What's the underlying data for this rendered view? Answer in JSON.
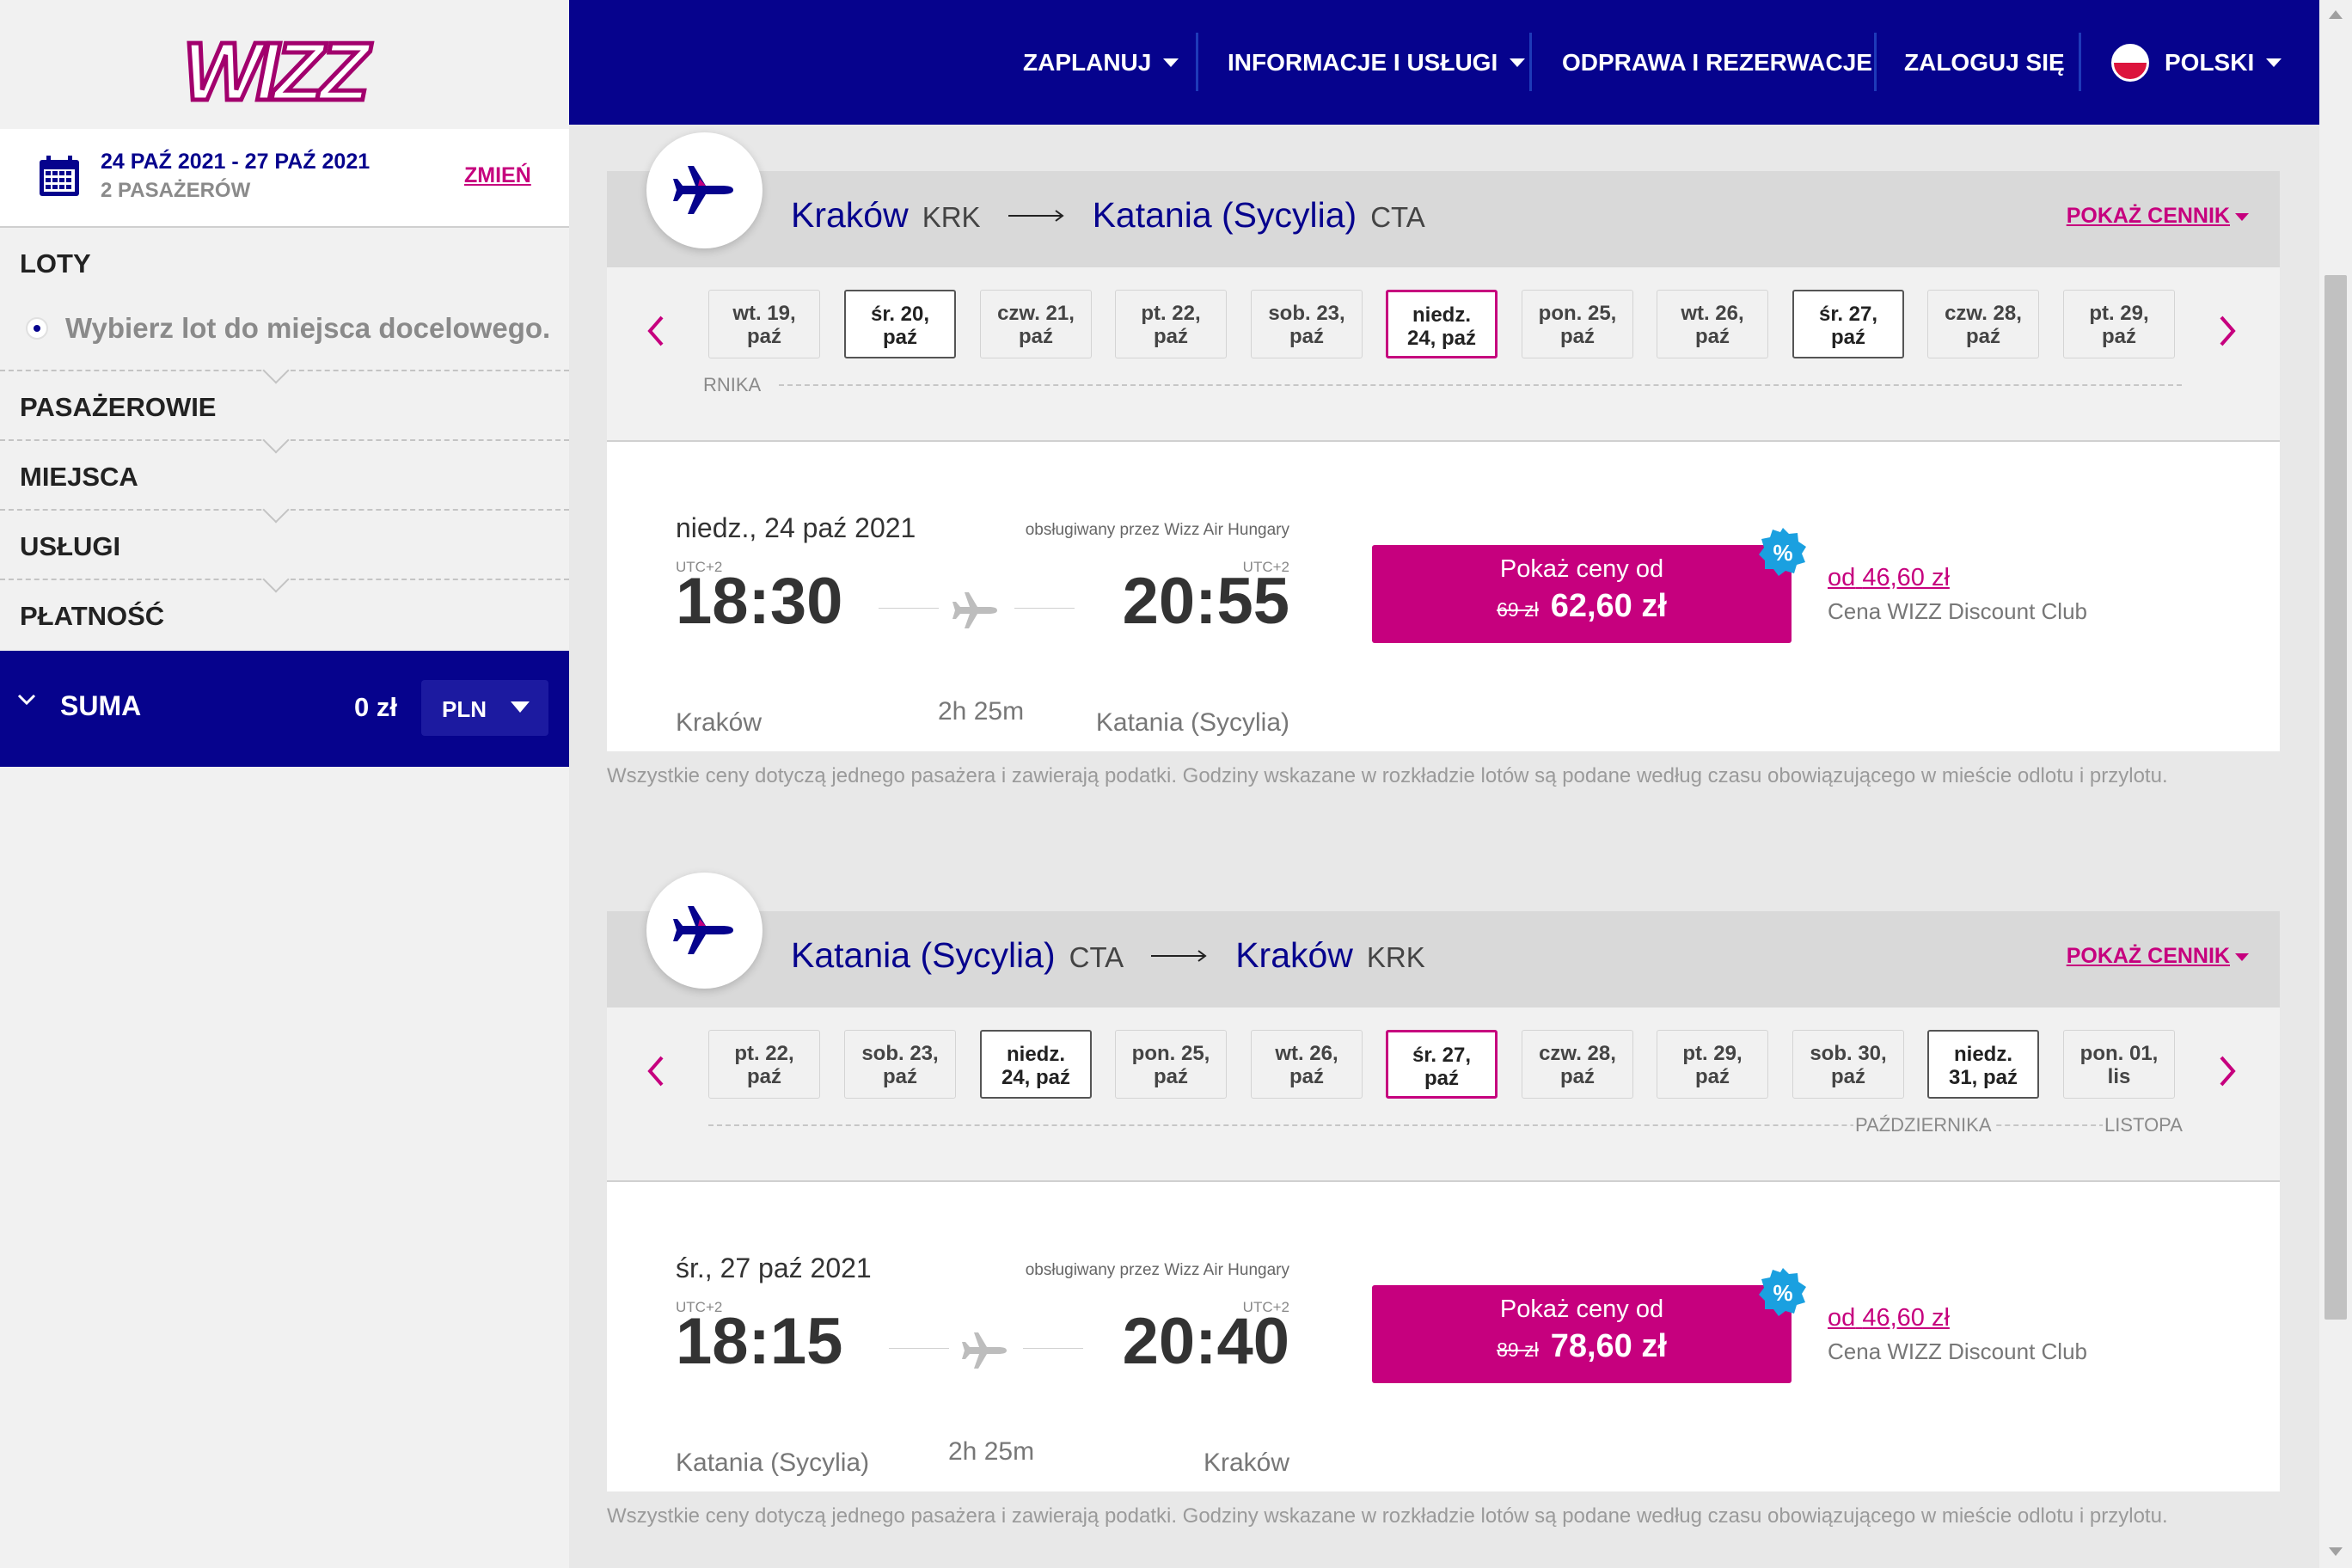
{
  "colors": {
    "brand_navy": "#06038d",
    "brand_magenta": "#c6007e",
    "discount_blue": "#1aa0e0"
  },
  "logo": {
    "text": "WIZZ"
  },
  "trip": {
    "dates": "24 PAŹ 2021 - 27 PAŹ 2021",
    "passengers": "2 PASAŻERÓW",
    "change_label": "ZMIEŃ"
  },
  "steps": [
    {
      "label": "LOTY",
      "sub": "Wybierz lot do miejsca docelowego."
    },
    {
      "label": "PASAŻEROWIE"
    },
    {
      "label": "MIEJSCA"
    },
    {
      "label": "USŁUGI"
    },
    {
      "label": "PŁATNOŚĆ"
    }
  ],
  "total": {
    "label": "SUMA",
    "amount": "0 zł",
    "currency": "PLN"
  },
  "nav": {
    "plan": "ZAPLANUJ",
    "info": "INFORMACJE I USŁUGI",
    "checkin": "ODPRAWA I REZERWACJE",
    "login": "ZALOGUJ SIĘ",
    "language": "POLSKI"
  },
  "flights": [
    {
      "from_city": "Kraków",
      "from_code": "KRK",
      "to_city": "Katania (Sycylia)",
      "to_code": "CTA",
      "show_prices": "POKAŻ CENNIK",
      "dates": [
        {
          "l1": "wt. 19,",
          "l2": "paź",
          "state": "none"
        },
        {
          "l1": "śr. 20,",
          "l2": "paź",
          "state": "avail"
        },
        {
          "l1": "czw. 21,",
          "l2": "paź",
          "state": "none"
        },
        {
          "l1": "pt. 22,",
          "l2": "paź",
          "state": "none"
        },
        {
          "l1": "sob. 23,",
          "l2": "paź",
          "state": "none"
        },
        {
          "l1": "niedz.",
          "l2": "24, paź",
          "state": "selected"
        },
        {
          "l1": "pon. 25,",
          "l2": "paź",
          "state": "none"
        },
        {
          "l1": "wt. 26,",
          "l2": "paź",
          "state": "none"
        },
        {
          "l1": "śr. 27,",
          "l2": "paź",
          "state": "avail"
        },
        {
          "l1": "czw. 28,",
          "l2": "paź",
          "state": "none"
        },
        {
          "l1": "pt. 29,",
          "l2": "paź",
          "state": "none"
        }
      ],
      "month_left": "RNIKA",
      "date": "niedz., 24 paź 2021",
      "operated_by": "obsługiwany przez Wizz Air Hungary",
      "dep_tz": "UTC+2",
      "arr_tz": "UTC+2",
      "dep_time": "18:30",
      "arr_time": "20:55",
      "duration": "2h 25m",
      "dep_city": "Kraków",
      "arr_city": "Katania (Sycylia)",
      "price_label": "Pokaż ceny od",
      "old_price": "69 zł",
      "price": "62,60 zł",
      "badge": "%",
      "club_from": "od",
      "club_price": "46,60 zł",
      "club_label": "Cena WIZZ Discount Club"
    },
    {
      "from_city": "Katania (Sycylia)",
      "from_code": "CTA",
      "to_city": "Kraków",
      "to_code": "KRK",
      "show_prices": "POKAŻ CENNIK",
      "dates": [
        {
          "l1": "pt. 22,",
          "l2": "paź",
          "state": "none"
        },
        {
          "l1": "sob. 23,",
          "l2": "paź",
          "state": "none"
        },
        {
          "l1": "niedz.",
          "l2": "24, paź",
          "state": "avail"
        },
        {
          "l1": "pon. 25,",
          "l2": "paź",
          "state": "none"
        },
        {
          "l1": "wt. 26,",
          "l2": "paź",
          "state": "none"
        },
        {
          "l1": "śr. 27,",
          "l2": "paź",
          "state": "selected"
        },
        {
          "l1": "czw. 28,",
          "l2": "paź",
          "state": "none"
        },
        {
          "l1": "pt. 29,",
          "l2": "paź",
          "state": "none"
        },
        {
          "l1": "sob. 30,",
          "l2": "paź",
          "state": "none"
        },
        {
          "l1": "niedz.",
          "l2": "31, paź",
          "state": "avail"
        },
        {
          "l1": "pon. 01,",
          "l2": "lis",
          "state": "none"
        }
      ],
      "month_mid": "PAŹDZIERNIKA",
      "month_right": "LISTOPA",
      "date": "śr., 27 paź 2021",
      "operated_by": "obsługiwany przez Wizz Air Hungary",
      "dep_tz": "UTC+2",
      "arr_tz": "UTC+2",
      "dep_time": "18:15",
      "arr_time": "20:40",
      "duration": "2h 25m",
      "dep_city": "Katania (Sycylia)",
      "arr_city": "Kraków",
      "price_label": "Pokaż ceny od",
      "old_price": "89 zł",
      "price": "78,60 zł",
      "badge": "%",
      "club_from": "od",
      "club_price": "46,60 zł",
      "club_label": "Cena WIZZ Discount Club"
    }
  ],
  "disclaimer": "Wszystkie ceny dotyczą jednego pasażera i zawierają podatki. Godziny wskazane w rozkładzie lotów są podane według czasu obowiązującego w mieście odlotu i przylotu."
}
